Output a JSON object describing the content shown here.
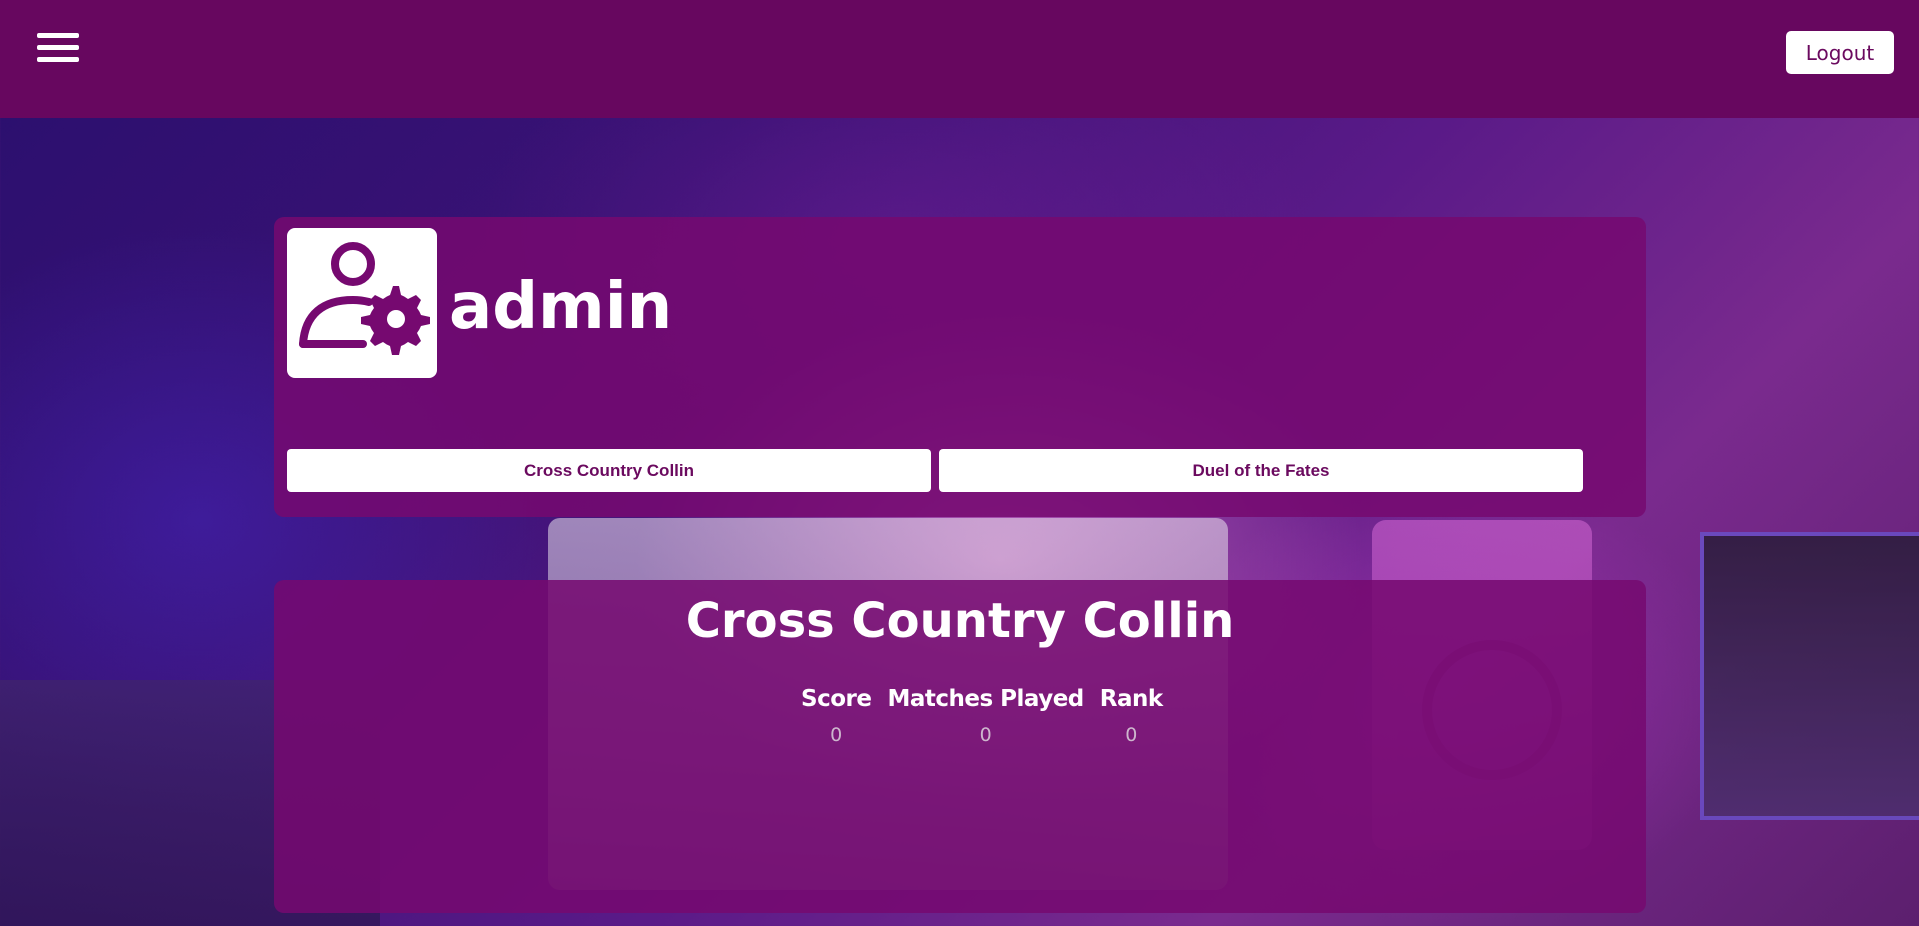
{
  "navbar": {
    "menu_icon": "hamburger-menu-icon",
    "logout_label": "Logout"
  },
  "profile": {
    "avatar_icon": "user-gear-icon",
    "username": "admin",
    "games": [
      {
        "label": "Cross Country Collin"
      },
      {
        "label": "Duel of the Fates"
      }
    ]
  },
  "stats": {
    "title": "Cross Country Collin",
    "headers": [
      "Score",
      "Matches Played",
      "Rank"
    ],
    "values": [
      "0",
      "0",
      "0"
    ]
  },
  "colors": {
    "brand_purple": "#67075f",
    "card_purple": "#760970",
    "button_text": "#6b0a5f"
  }
}
